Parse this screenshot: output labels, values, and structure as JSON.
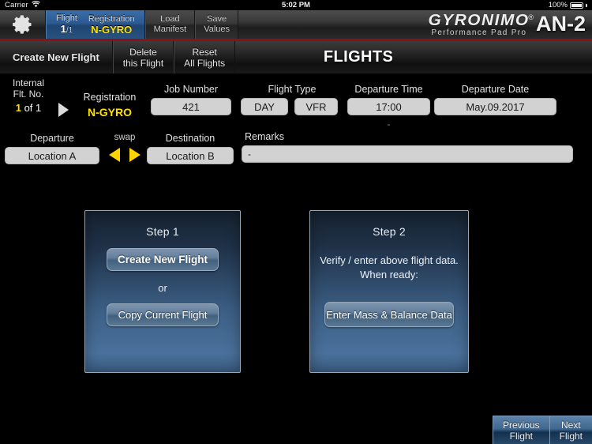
{
  "statusbar": {
    "carrier": "Carrier",
    "wifi_icon": "wifi-icon",
    "time": "5:02 PM",
    "battery_percent": "100%"
  },
  "toolbar": {
    "gear_icon": "gear-icon",
    "flight_tab": {
      "flight_label": "Flight",
      "flight_value": "1",
      "flight_total": "/1",
      "registration_label": "Registration",
      "registration_value": "N-GYRO"
    },
    "load_manifest": {
      "line1": "Load",
      "line2": "Manifest"
    },
    "save_values": {
      "line1": "Save",
      "line2": "Values"
    },
    "brand": {
      "name": "GYRONIMO",
      "registered": "®",
      "tagline": "Performance Pad Pro",
      "model": "AN-2"
    },
    "accent_red": "#8e1010",
    "accent_blue": "#2c5a92"
  },
  "subbar": {
    "create_new_flight": "Create New Flight",
    "delete_this_flight": {
      "line1": "Delete",
      "line2": "this Flight"
    },
    "reset_all_flights": {
      "line1": "Reset",
      "line2": "All Flights"
    },
    "page_title": "FLIGHTS"
  },
  "form": {
    "internal_flt_no": {
      "label_line1": "Internal",
      "label_line2": "Flt. No.",
      "value_current": "1",
      "value_rest": " of 1",
      "next_icon": "play-triangle-icon"
    },
    "registration": {
      "label": "Registration",
      "value": "N-GYRO"
    },
    "job_number": {
      "label": "Job Number",
      "value": "421"
    },
    "flight_type": {
      "label": "Flight Type",
      "value_day": "DAY",
      "value_rules": "VFR"
    },
    "departure_time": {
      "label": "Departure Time",
      "value": "17:00",
      "sub_dash": "-"
    },
    "departure_date": {
      "label": "Departure Date",
      "value": "May.09.2017"
    },
    "departure": {
      "label": "Departure",
      "value": "Location A"
    },
    "swap": {
      "label": "swap",
      "left_icon": "swap-left-arrow-icon",
      "right_icon": "swap-right-arrow-icon"
    },
    "destination": {
      "label": "Destination",
      "value": "Location B"
    },
    "remarks": {
      "label": "Remarks",
      "value": "-"
    }
  },
  "step1": {
    "title": "Step 1",
    "create_button": "Create New Flight",
    "or": "or",
    "copy_button": "Copy Current Flight"
  },
  "step2": {
    "title": "Step 2",
    "text_line1": "Verify / enter above flight data.",
    "text_line2": "When ready:",
    "enter_button": "Enter Mass & Balance Data"
  },
  "bottomnav": {
    "previous": {
      "line1": "Previous",
      "line2": "Flight"
    },
    "next": {
      "line1": "Next",
      "line2": "Flight"
    }
  }
}
